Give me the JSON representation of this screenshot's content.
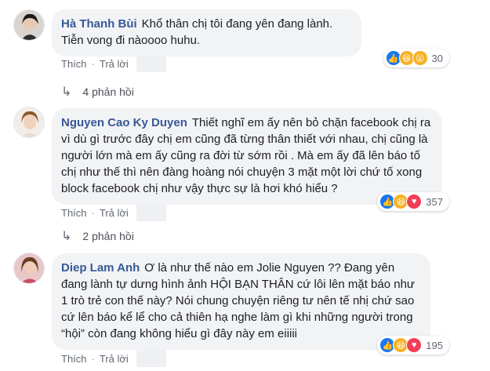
{
  "comments": [
    {
      "author": "Hà Thanh Bùi",
      "text": "Khổ thân chị tôi đang yên đang lành. Tiễn vong đi nàoooo huhu.",
      "like_label": "Thích",
      "reply_label": "Trả lời",
      "reaction_count": "30",
      "reactions": [
        "like-icon",
        "haha-icon",
        "wow-icon"
      ],
      "replies_label": "4 phản hồi"
    },
    {
      "author": "Nguyen Cao Ky Duyen",
      "text": "Thiết nghĩ em ấy nên bỏ chặn facebook chị ra vì dù gì trước đây chị em cũng đã từng thân thiết với nhau, chị cũng là người lớn mà em ấy cũng ra đời từ sớm rồi . Mà em ấy đã lên báo tố chị như thế thì nên đàng hoàng nói chuyện 3 mặt một lời chứ tố xong block facebook chị như vậy thực sự là hơi khó hiểu ?",
      "like_label": "Thích",
      "reply_label": "Trả lời",
      "reaction_count": "357",
      "reactions": [
        "like-icon",
        "haha-icon",
        "love-icon"
      ],
      "replies_label": "2 phản hồi"
    },
    {
      "author": "Diep Lam Anh",
      "text": "Ơ là như thế nào em Jolie Nguyen ?? Đang yên đang lành tự dưng hình ảnh HỘI BẠN THÂN cứ lôi lên mặt báo như 1 trò trẻ con thế này? Nói chung chuyện riêng tư nên tế nhị chứ sao cứ lên báo kể lể cho cả thiên hạ nghe làm gì khi những người trong “hội” còn đang không hiểu gì đây này em eiiiii",
      "like_label": "Thích",
      "reply_label": "Trả lời",
      "reaction_count": "195",
      "reactions": [
        "like-icon",
        "haha-icon",
        "love-icon"
      ]
    }
  ],
  "colors": {
    "author": "#385898",
    "bubble": "#f2f3f5",
    "like": "#1877f2",
    "love": "#f33e58",
    "haha": "#f7b125"
  }
}
